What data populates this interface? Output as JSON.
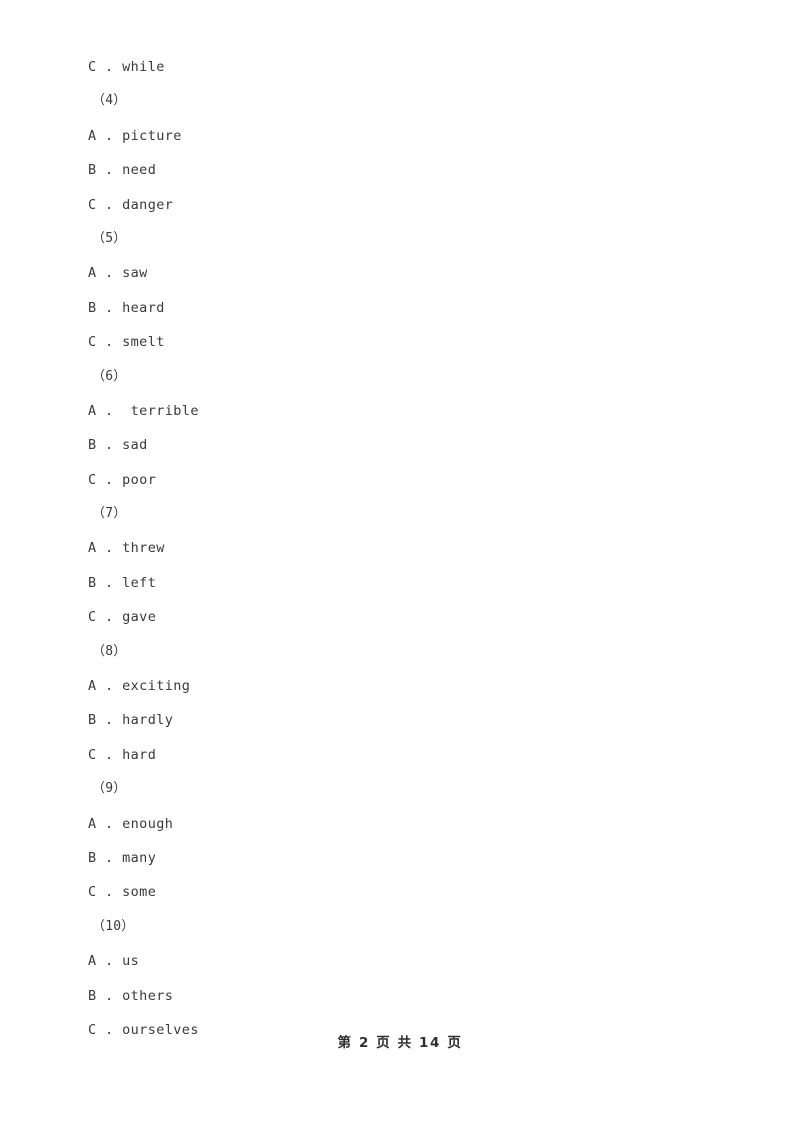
{
  "document": {
    "background_color": "#ffffff",
    "text_color": "#3a3a3a",
    "blocks": [
      {
        "kind": "option",
        "text": "C . while"
      },
      {
        "kind": "question",
        "text": "（4）"
      },
      {
        "kind": "option",
        "text": "A . picture"
      },
      {
        "kind": "option",
        "text": "B . need"
      },
      {
        "kind": "option",
        "text": "C . danger"
      },
      {
        "kind": "question",
        "text": "（5）"
      },
      {
        "kind": "option",
        "text": "A . saw"
      },
      {
        "kind": "option",
        "text": "B . heard"
      },
      {
        "kind": "option",
        "text": "C . smelt"
      },
      {
        "kind": "question",
        "text": "（6）"
      },
      {
        "kind": "option",
        "text": "A .  terrible"
      },
      {
        "kind": "option",
        "text": "B . sad"
      },
      {
        "kind": "option",
        "text": "C . poor"
      },
      {
        "kind": "question",
        "text": "（7）"
      },
      {
        "kind": "option",
        "text": "A . threw"
      },
      {
        "kind": "option",
        "text": "B . left"
      },
      {
        "kind": "option",
        "text": "C . gave"
      },
      {
        "kind": "question",
        "text": "（8）"
      },
      {
        "kind": "option",
        "text": "A . exciting"
      },
      {
        "kind": "option",
        "text": "B . hardly"
      },
      {
        "kind": "option",
        "text": "C . hard"
      },
      {
        "kind": "question",
        "text": "（9）"
      },
      {
        "kind": "option",
        "text": "A . enough"
      },
      {
        "kind": "option",
        "text": "B . many"
      },
      {
        "kind": "option",
        "text": "C . some"
      },
      {
        "kind": "question",
        "text": "（10）"
      },
      {
        "kind": "option",
        "text": "A . us"
      },
      {
        "kind": "option",
        "text": "B . others"
      },
      {
        "kind": "option",
        "text": "C . ourselves"
      }
    ]
  },
  "footer": {
    "page_text": "第 2 页 共 14 页",
    "current_page": "2",
    "total_pages": "14"
  }
}
